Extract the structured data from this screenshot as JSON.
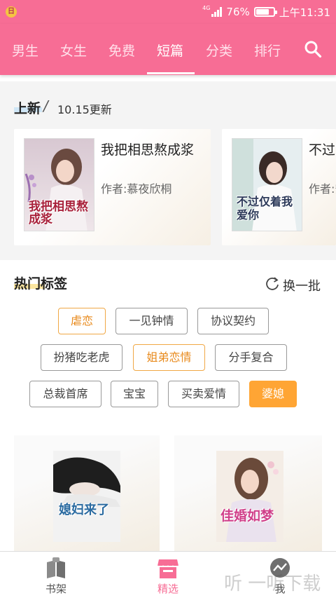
{
  "status_bar": {
    "app_badge": "日",
    "network": "4G",
    "battery": "76%",
    "battery_level": 0.76,
    "time": "上午11:31"
  },
  "nav": {
    "tabs": [
      "男生",
      "女生",
      "免费",
      "短篇",
      "分类",
      "排行"
    ],
    "active_tab": "短篇",
    "search_icon": "search-icon"
  },
  "new_section": {
    "title": "上新",
    "update": "10.15更新",
    "books": [
      {
        "title": "我把相思熬成浆",
        "author": "作者:慕夜欣桐",
        "cover_text": "我把相思熬成浆"
      },
      {
        "title": "不过",
        "author": "作者:安",
        "cover_text": "不过仅着我爱你"
      }
    ]
  },
  "hot_tags": {
    "title": "热门标签",
    "refresh_label": "换一批",
    "tags": [
      "虐恋",
      "一见钟情",
      "协议契约",
      "扮猪吃老虎",
      "姐弟恋情",
      "分手复合",
      "总裁首席",
      "宝宝",
      "买卖爱情",
      "婆媳"
    ]
  },
  "bottom_books": [
    {
      "cover_text": "媳妇来了"
    },
    {
      "cover_text": "佳婚如梦"
    }
  ],
  "bottom_nav": {
    "items": [
      "书架",
      "精选",
      "我"
    ],
    "active": "精选"
  },
  "watermark": "听 一听下载",
  "colors": {
    "brand_pink": "#f76d95",
    "accent_orange": "#ffa534"
  }
}
